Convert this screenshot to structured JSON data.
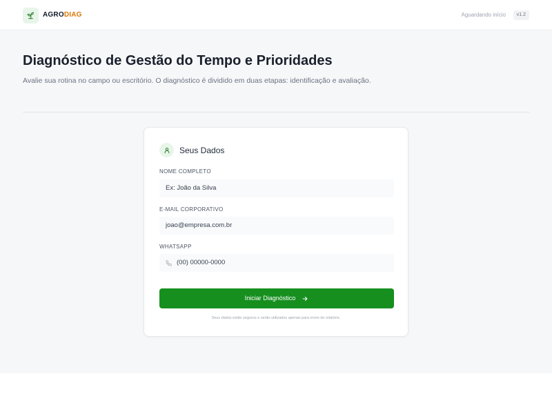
{
  "header": {
    "brand_part1": "AGRO",
    "brand_part2": "DIAG",
    "logo_icon": "sprout-icon",
    "status": "Aguardando início",
    "version": "v1.2"
  },
  "page": {
    "title": "Diagnóstico de Gestão do Tempo e Prioridades",
    "subtitle": "Avalie sua rotina no campo ou escritório. O diagnóstico é dividido em duas etapas: identificação e avaliação."
  },
  "form": {
    "section_icon": "user-icon",
    "section_title": "Seus Dados",
    "name": {
      "label": "NOME COMPLETO",
      "placeholder": "Ex: João da Silva"
    },
    "email": {
      "label": "E-MAIL CORPORATIVO",
      "placeholder": "joao@empresa.com.br"
    },
    "whatsapp": {
      "label": "WHATSAPP",
      "icon": "phone-icon",
      "placeholder": "(00) 00000-0000"
    },
    "submit_label": "Iniciar Diagnóstico",
    "submit_icon": "arrow-right-icon",
    "privacy_note": "Seus dados estão seguros e serão utilizados apenas para envio do relatório."
  },
  "colors": {
    "accent": "#168f1f",
    "brand_orange": "#d97706",
    "background": "#f6f7f9"
  }
}
